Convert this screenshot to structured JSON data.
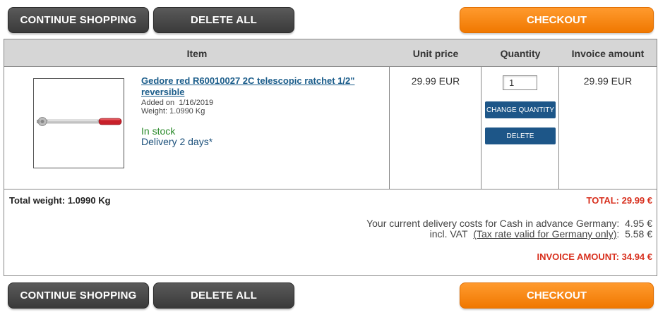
{
  "buttons": {
    "continue_shopping": "CONTINUE SHOPPING",
    "delete_all": "DELETE ALL",
    "checkout": "CHECKOUT"
  },
  "table": {
    "headers": {
      "item": "Item",
      "unit_price": "Unit price",
      "quantity": "Quantity",
      "invoice_amount": "Invoice amount"
    }
  },
  "item": {
    "name": "Gedore red R60010027 2C telescopic ratchet 1/2\" reversible",
    "added_label": "Added on",
    "added_date": "1/16/2019",
    "weight_label": "Weight:",
    "weight_value": "1.0990 Kg",
    "stock": "In stock",
    "delivery": "Delivery 2 days*",
    "unit_price": "29.99 EUR",
    "quantity": "1",
    "invoice_amount": "29.99 EUR",
    "change_quantity_label": "CHANGE QUANTITY",
    "delete_label": "DELETE"
  },
  "totals": {
    "total_weight_label": "Total weight:",
    "total_weight_value": "1.0990 Kg",
    "total_label": "TOTAL:",
    "total_value": "29.99 €",
    "delivery_text": "Your current delivery costs for Cash in advance Germany:",
    "delivery_value": "4.95 €",
    "vat_prefix": "incl. VAT",
    "vat_link": "(Tax rate valid for Germany only)",
    "vat_value": "5.58 €",
    "invoice_label": "INVOICE AMOUNT:",
    "invoice_value": "34.94 €"
  },
  "colors": {
    "checkout": "#f58a0f",
    "dark_button": "#444444",
    "blue_button": "#1d5688",
    "link": "#1a5c8a",
    "total_red": "#d8301e",
    "in_stock": "#2a8a2a"
  }
}
